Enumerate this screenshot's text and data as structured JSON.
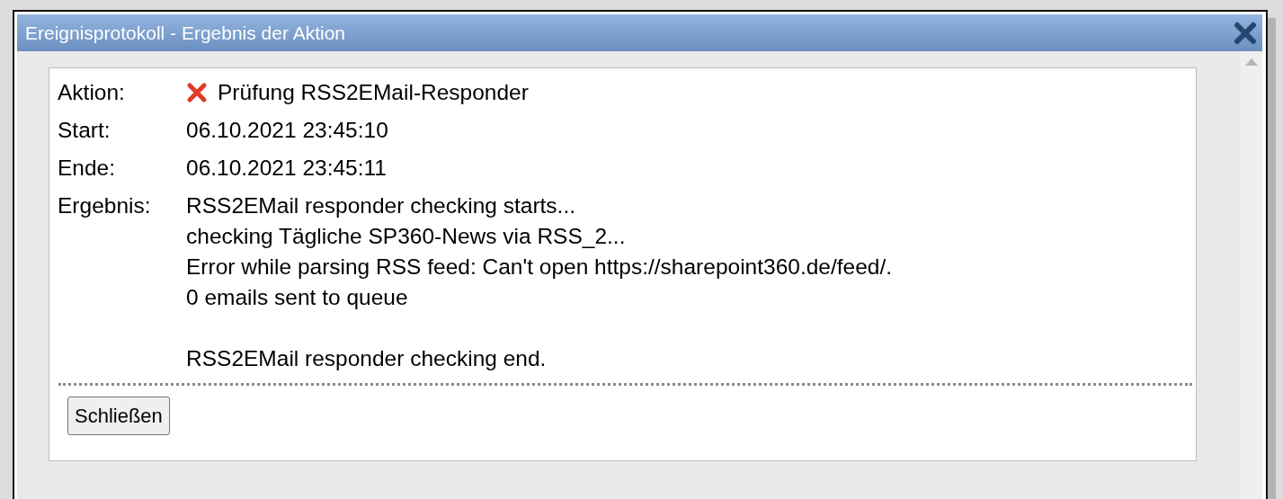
{
  "dialog": {
    "title": "Ereignisprotokoll - Ergebnis der Aktion"
  },
  "details": [
    {
      "label": "Aktion:",
      "value": "Prüfung RSS2EMail-Responder",
      "failed": true
    },
    {
      "label": "Start:",
      "value": "06.10.2021 23:45:10"
    },
    {
      "label": "Ende:",
      "value": "06.10.2021 23:45:11"
    }
  ],
  "result": {
    "label": "Ergebnis:",
    "lines": [
      "RSS2EMail responder checking starts...",
      "checking Tägliche SP360-News via RSS_2...",
      "Error while parsing RSS feed: Can't open https://sharepoint360.de/feed/.",
      "0 emails sent to queue"
    ],
    "final_line": "RSS2EMail responder checking end."
  },
  "buttons": [
    "Schließen"
  ]
}
